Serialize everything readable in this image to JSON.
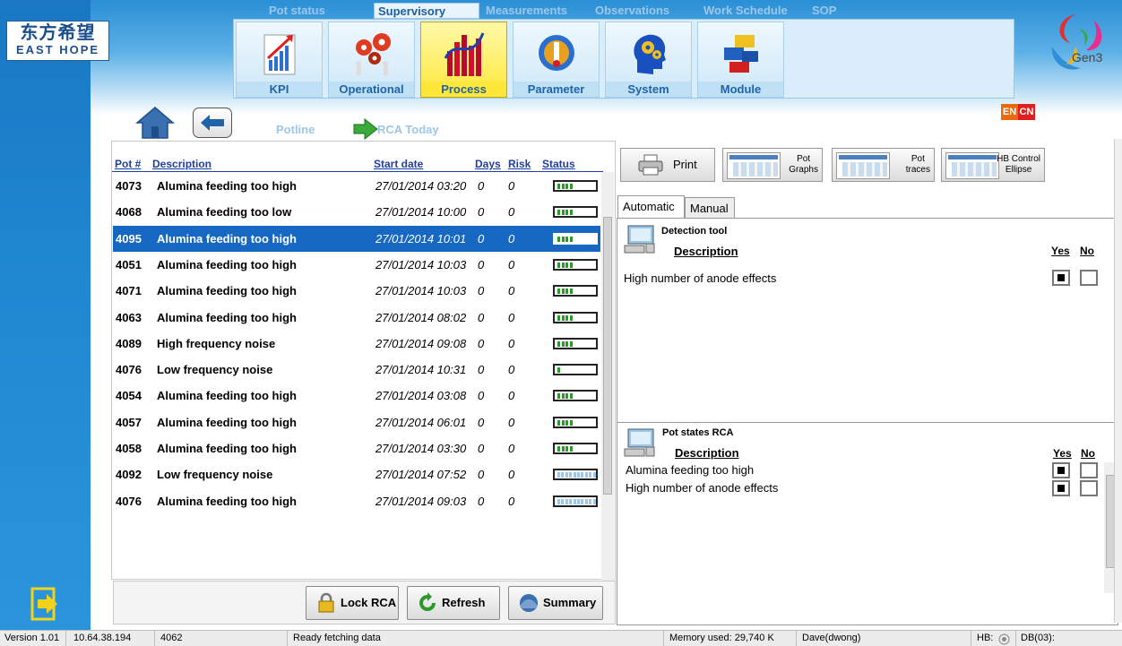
{
  "brand": {
    "logo_cn": "东方希望",
    "logo_en": "EAST HOPE",
    "gen3": "Gen3",
    "lang_en": "EN",
    "lang_cn": "CN"
  },
  "nav_tabs": [
    "Pot status",
    "Supervisory",
    "Measurements",
    "Observations",
    "Work Schedule",
    "SOP"
  ],
  "active_nav_tab": "Supervisory",
  "menu": [
    {
      "label": "KPI",
      "icon": "kpi-chart-icon"
    },
    {
      "label": "Operational",
      "icon": "gears-people-icon"
    },
    {
      "label": "Process",
      "icon": "process-bars-icon",
      "active": true
    },
    {
      "label": "Parameter",
      "icon": "parameter-globe-icon"
    },
    {
      "label": "System",
      "icon": "system-head-icon"
    },
    {
      "label": "Module",
      "icon": "module-blocks-icon"
    }
  ],
  "breadcrumb": {
    "potline": "Potline",
    "rca_today": "RCA Today"
  },
  "list": {
    "headers": {
      "pot": "Pot #",
      "description": "Description",
      "start_date": "Start date",
      "days": "Days",
      "risk": "Risk",
      "status": "Status"
    },
    "rows": [
      {
        "pot": "4073",
        "description": "Alumina feeding too high",
        "start": "27/01/2014 03:20",
        "days": "0",
        "risk": "0",
        "status_level": 4,
        "status_color": "green"
      },
      {
        "pot": "4068",
        "description": "Alumina feeding too low",
        "start": "27/01/2014 10:00",
        "days": "0",
        "risk": "0",
        "status_level": 4,
        "status_color": "green"
      },
      {
        "pot": "4095",
        "description": "Alumina feeding too high",
        "start": "27/01/2014 10:01",
        "days": "0",
        "risk": "0",
        "status_level": 4,
        "status_color": "green",
        "selected": true
      },
      {
        "pot": "4051",
        "description": "Alumina feeding too high",
        "start": "27/01/2014 10:03",
        "days": "0",
        "risk": "0",
        "status_level": 4,
        "status_color": "green"
      },
      {
        "pot": "4071",
        "description": "Alumina feeding too high",
        "start": "27/01/2014 10:03",
        "days": "0",
        "risk": "0",
        "status_level": 4,
        "status_color": "green"
      },
      {
        "pot": "4063",
        "description": "Alumina feeding too high",
        "start": "27/01/2014 08:02",
        "days": "0",
        "risk": "0",
        "status_level": 4,
        "status_color": "green"
      },
      {
        "pot": "4089",
        "description": "High frequency noise",
        "start": "27/01/2014 09:08",
        "days": "0",
        "risk": "0",
        "status_level": 4,
        "status_color": "green"
      },
      {
        "pot": "4076",
        "description": "Low frequency noise",
        "start": "27/01/2014 10:31",
        "days": "0",
        "risk": "0",
        "status_level": 1,
        "status_color": "green"
      },
      {
        "pot": "4054",
        "description": "Alumina feeding too high",
        "start": "27/01/2014 03:08",
        "days": "0",
        "risk": "0",
        "status_level": 4,
        "status_color": "green"
      },
      {
        "pot": "4057",
        "description": "Alumina feeding too high",
        "start": "27/01/2014 06:01",
        "days": "0",
        "risk": "0",
        "status_level": 4,
        "status_color": "green"
      },
      {
        "pot": "4058",
        "description": "Alumina feeding too high",
        "start": "27/01/2014 03:30",
        "days": "0",
        "risk": "0",
        "status_level": 4,
        "status_color": "green"
      },
      {
        "pot": "4092",
        "description": "Low frequency noise",
        "start": "27/01/2014 07:52",
        "days": "0",
        "risk": "0",
        "status_level": 10,
        "status_color": "blue"
      },
      {
        "pot": "4076",
        "description": "Alumina feeding too high",
        "start": "27/01/2014 09:03",
        "days": "0",
        "risk": "0",
        "status_level": 10,
        "status_color": "blue"
      }
    ]
  },
  "buttons": {
    "lock_rca": "Lock RCA",
    "refresh": "Refresh",
    "summary": "Summary",
    "print": "Print"
  },
  "thumb_buttons": [
    {
      "label": "Pot\nGraphs"
    },
    {
      "label": "Pot\ntraces"
    },
    {
      "label": "HB Control\nEllipse"
    }
  ],
  "right_tabs": {
    "automatic": "Automatic",
    "manual": "Manual"
  },
  "detection": {
    "title": "Detection tool",
    "desc_header": "Description",
    "yes": "Yes",
    "no": "No",
    "items": [
      {
        "text": "High number of anode effects",
        "yes": true,
        "no": false
      }
    ]
  },
  "pot_states": {
    "title": "Pot states RCA",
    "desc_header": "Description",
    "yes": "Yes",
    "no": "No",
    "items": [
      {
        "text": "Alumina feeding too high",
        "yes": true,
        "no": false
      },
      {
        "text": "High number of anode effects",
        "yes": true,
        "no": false
      }
    ]
  },
  "status_bar": {
    "version": "Version 1.01",
    "ip": "10.64.38.194",
    "pot": "4062",
    "message": "Ready fetching data",
    "memory": "Memory used: 29,740 K",
    "user": "Dave(dwong)",
    "hb": "HB:",
    "db": "DB(03):"
  }
}
